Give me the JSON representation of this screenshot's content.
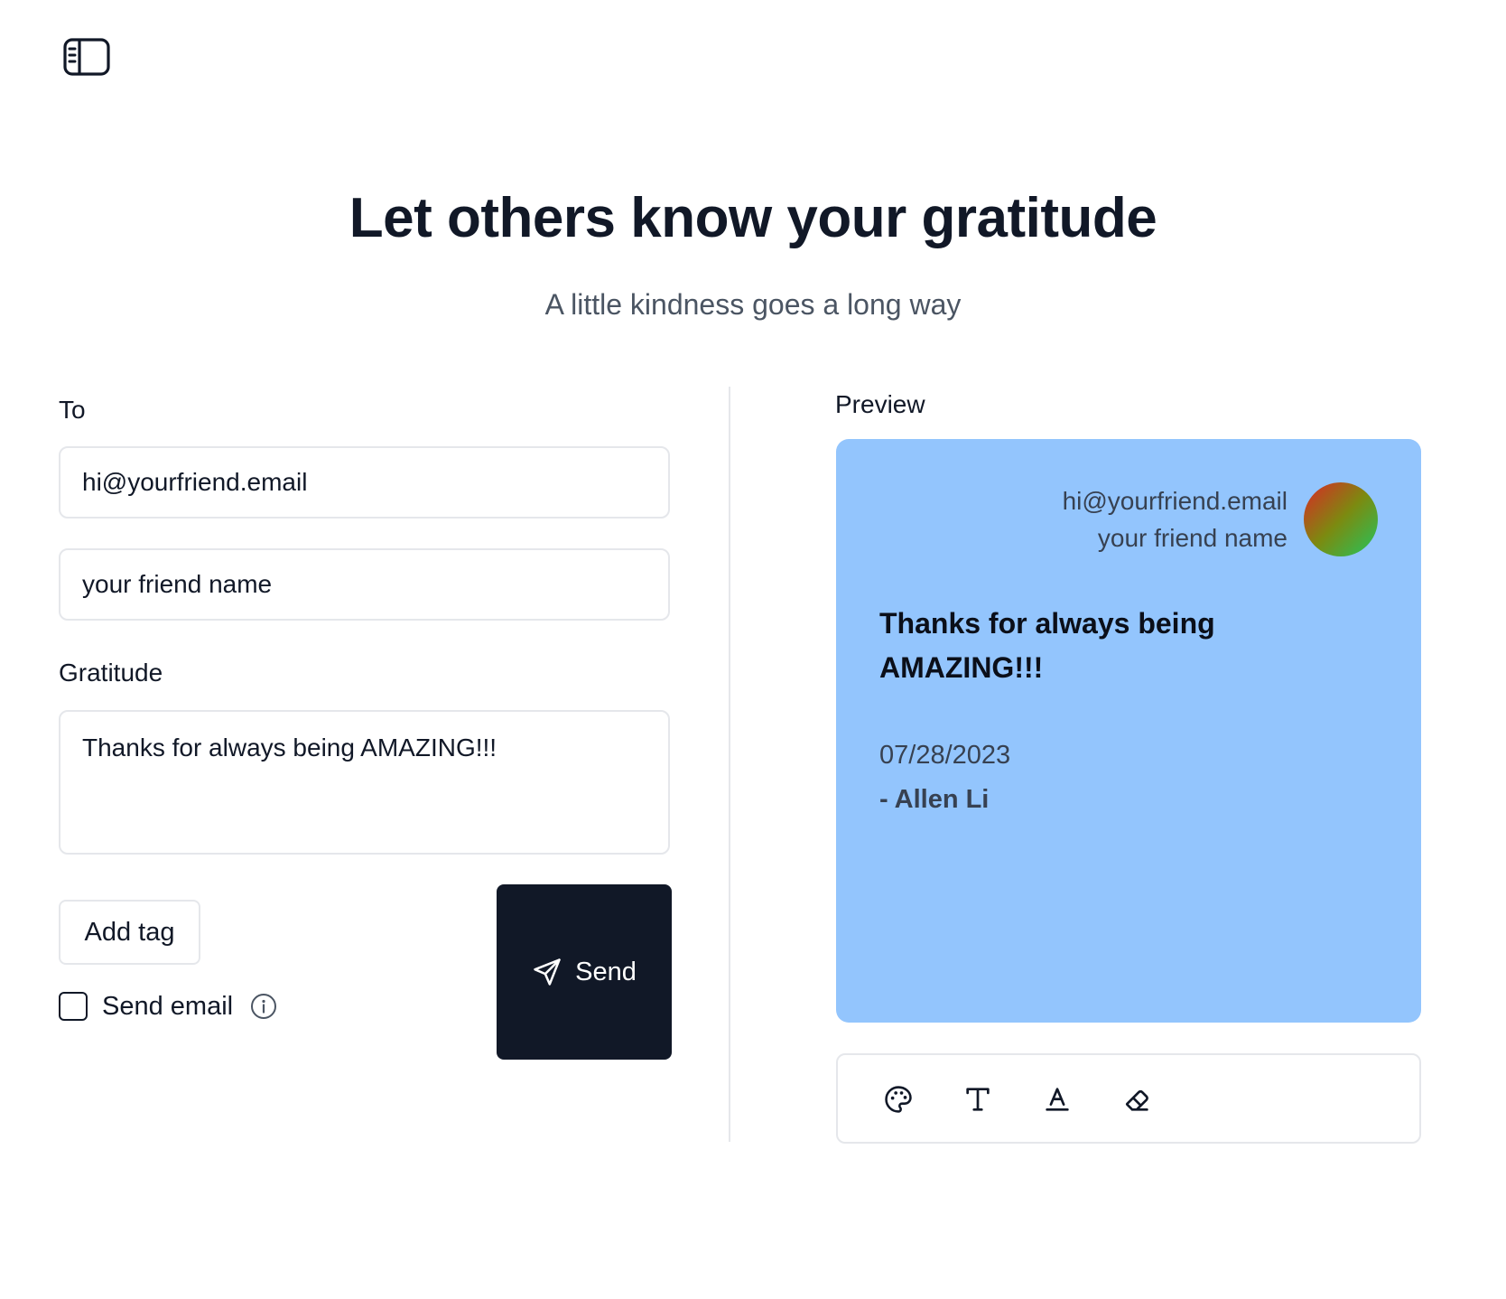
{
  "header": {
    "sidebar_toggle_icon": "sidebar-toggle-icon"
  },
  "hero": {
    "title": "Let others know your gratitude",
    "subtitle": "A little kindness goes a long way"
  },
  "form": {
    "to_label": "To",
    "email_value": "hi@yourfriend.email",
    "name_value": "your friend name",
    "gratitude_label": "Gratitude",
    "gratitude_value": "Thanks for always being AMAZING!!!",
    "add_tag_label": "Add tag",
    "send_email_label": "Send email",
    "send_email_checked": false,
    "send_label": "Send"
  },
  "preview": {
    "label": "Preview",
    "card_color": "#93c5fd",
    "recipient_email": "hi@yourfriend.email",
    "recipient_name": "your friend name",
    "message": "Thanks for always being AMAZING!!!",
    "date": "07/28/2023",
    "author": "- Allen Li"
  },
  "toolbar": {
    "tools": [
      "palette-icon",
      "text-type-icon",
      "text-color-icon",
      "eraser-icon"
    ]
  },
  "colors": {
    "primary_dark": "#111827",
    "card_blue": "#93c5fd",
    "border": "#e5e7eb"
  }
}
